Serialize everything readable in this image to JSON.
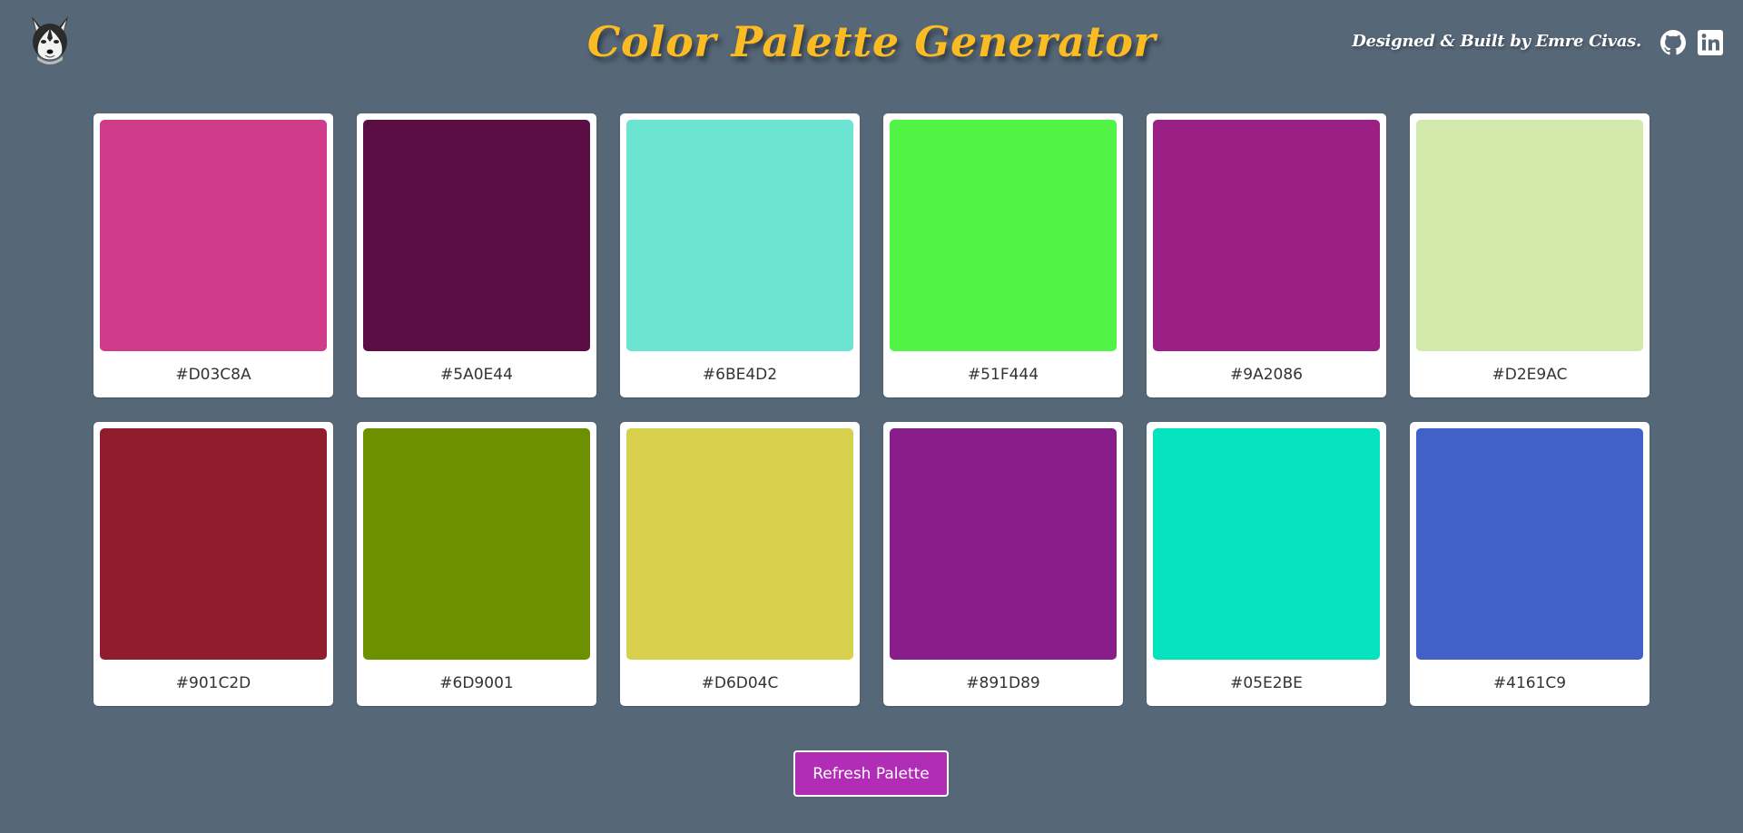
{
  "header": {
    "logo_icon": "husky-logo-icon",
    "title": "Color Palette Generator",
    "title_color": "#FBBB22",
    "credit": "Designed & Built by Emre Civas.",
    "social": {
      "github_icon": "github-icon",
      "linkedin_icon": "linkedin-icon"
    }
  },
  "palette": {
    "colors": [
      {
        "hex": "#D03C8A",
        "label": "#D03C8A"
      },
      {
        "hex": "#5A0E44",
        "label": "#5A0E44"
      },
      {
        "hex": "#6BE4D2",
        "label": "#6BE4D2"
      },
      {
        "hex": "#51F444",
        "label": "#51F444"
      },
      {
        "hex": "#9A2086",
        "label": "#9A2086"
      },
      {
        "hex": "#D2E9AC",
        "label": "#D2E9AC"
      },
      {
        "hex": "#901C2D",
        "label": "#901C2D"
      },
      {
        "hex": "#6D9001",
        "label": "#6D9001"
      },
      {
        "hex": "#D6D04C",
        "label": "#D6D04C"
      },
      {
        "hex": "#891D89",
        "label": "#891D89"
      },
      {
        "hex": "#05E2BE",
        "label": "#05E2BE"
      },
      {
        "hex": "#4161C9",
        "label": "#4161C9"
      }
    ]
  },
  "actions": {
    "refresh_label": "Refresh Palette",
    "refresh_color": "#B12DB5"
  },
  "theme": {
    "background": "#566778"
  }
}
